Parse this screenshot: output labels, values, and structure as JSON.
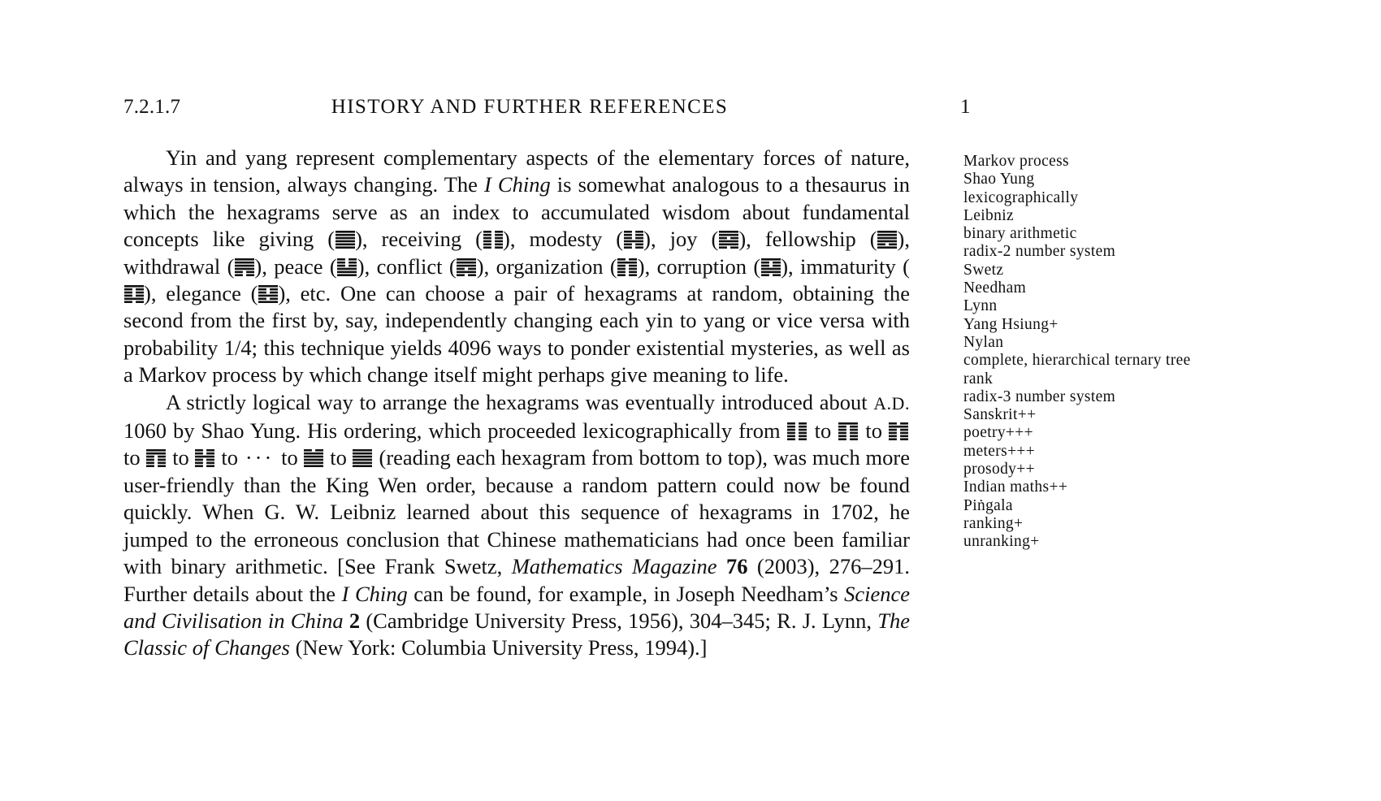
{
  "page": {
    "section_number": "7.2.1.7",
    "running_head": "HISTORY AND FURTHER REFERENCES",
    "folio": "1"
  },
  "paragraph1": {
    "seg_a": "Yin and yang represent complementary aspects of the elementary forces of nature, always in tension, always changing. The ",
    "i_ching_1": "I Ching",
    "seg_b": " is somewhat analogous to a thesaurus in which the hexagrams serve as an index to accumulated wisdom about fundamental concepts like giving (",
    "seg_c": "), receiving (",
    "seg_d": "), modesty (",
    "seg_e": "), joy (",
    "seg_f": "), fellowship (",
    "seg_g": "), withdrawal (",
    "seg_h": "), peace (",
    "seg_i": "), conflict (",
    "seg_j": "), organization (",
    "seg_k": "), corruption (",
    "seg_l": "), immaturity (",
    "seg_m": "), elegance (",
    "seg_n": "), etc. One can choose a pair of hexagrams at random, obtaining the second from the first by, say, independently changing each yin to yang or vice versa with probability 1/4; this technique yields 4096 ways to ponder existential mysteries, as well as a Markov process by which change itself might perhaps give meaning to life."
  },
  "paragraph1_hexagrams": [
    {
      "name": "giving",
      "lines": [
        1,
        1,
        1,
        1,
        1,
        1
      ]
    },
    {
      "name": "receiving",
      "lines": [
        0,
        0,
        0,
        0,
        0,
        0
      ]
    },
    {
      "name": "modesty",
      "lines": [
        0,
        0,
        1,
        0,
        0,
        0
      ]
    },
    {
      "name": "joy",
      "lines": [
        0,
        1,
        1,
        0,
        1,
        1
      ]
    },
    {
      "name": "fellowship",
      "lines": [
        1,
        0,
        1,
        1,
        1,
        1
      ]
    },
    {
      "name": "withdrawal",
      "lines": [
        0,
        0,
        1,
        1,
        1,
        1
      ]
    },
    {
      "name": "peace",
      "lines": [
        1,
        1,
        1,
        0,
        0,
        0
      ]
    },
    {
      "name": "conflict",
      "lines": [
        0,
        1,
        0,
        1,
        1,
        1
      ]
    },
    {
      "name": "organization",
      "lines": [
        0,
        0,
        0,
        0,
        1,
        0
      ]
    },
    {
      "name": "corruption",
      "lines": [
        0,
        1,
        1,
        0,
        0,
        1
      ]
    },
    {
      "name": "immaturity",
      "lines": [
        0,
        1,
        0,
        0,
        0,
        1
      ]
    },
    {
      "name": "elegance",
      "lines": [
        1,
        0,
        1,
        0,
        0,
        1
      ]
    }
  ],
  "paragraph2": {
    "seg_a": "A strictly logical way to arrange the hexagrams was eventually introduced about ",
    "ad": "A.D.",
    "seg_b": " 1060 by Shao Yung. His ordering, which proceeded lexicographically from ",
    "to": " to ",
    "ellipsis": "···",
    "seg_c": " (reading each hexagram from bottom to top), was much more user-friendly than the King Wen order, because a random pattern could now be found quickly. When G. W. Leibniz learned about this sequence of hexagrams in 1702, he jumped to the erroneous conclusion that Chinese mathematicians had once been familiar with binary arithmetic. [See Frank Swetz, ",
    "ref1_title": "Mathematics Magazine",
    "ref1_vol": "76",
    "seg_d": " (2003), 276–291. Further details about the ",
    "i_ching_2": "I Ching",
    "seg_e": " can be found, for example, in Joseph Needham’s ",
    "ref2_title": "Science and Civilisation in China",
    "ref2_vol": "2",
    "seg_f": " (Cambridge University Press, 1956), 304–345; R. J. Lynn, ",
    "ref3_title": "The Classic of Changes",
    "seg_g": " (New York: Columbia University Press, 1994).]"
  },
  "paragraph2_hexagrams": [
    {
      "order": 1,
      "lines": [
        0,
        0,
        0,
        0,
        0,
        0
      ]
    },
    {
      "order": 2,
      "lines": [
        0,
        0,
        0,
        0,
        0,
        1
      ]
    },
    {
      "order": 3,
      "lines": [
        0,
        0,
        0,
        0,
        1,
        0
      ]
    },
    {
      "order": 4,
      "lines": [
        0,
        0,
        0,
        0,
        1,
        1
      ]
    },
    {
      "order": 5,
      "lines": [
        0,
        0,
        0,
        1,
        0,
        0
      ]
    },
    {
      "order": 63,
      "lines": [
        1,
        1,
        1,
        1,
        1,
        0
      ]
    },
    {
      "order": 64,
      "lines": [
        1,
        1,
        1,
        1,
        1,
        1
      ]
    }
  ],
  "margin_notes": [
    "Markov process",
    "Shao Yung",
    "lexicographically",
    "Leibniz",
    "binary arithmetic",
    "radix-2 number system",
    "Swetz",
    "Needham",
    "Lynn",
    "Yang Hsiung+",
    "Nylan",
    "complete, hierarchical ternary tree",
    "rank",
    "radix-3 number system",
    "Sanskrit++",
    "poetry+++",
    "meters+++",
    "prosody++",
    "Indian maths++",
    "Piṅgala",
    "ranking+",
    "unranking+"
  ],
  "colors": {
    "ink": "#111111",
    "paper": "#ffffff"
  }
}
